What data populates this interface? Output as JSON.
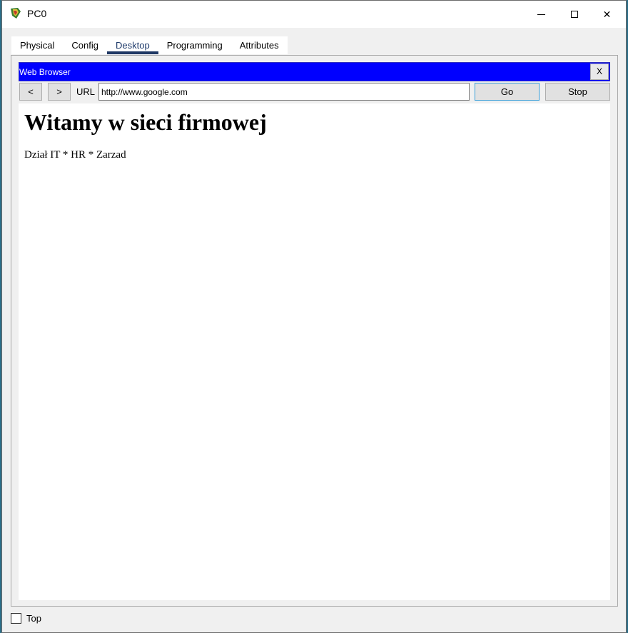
{
  "window": {
    "title": "PC0",
    "icon": "packet-tracer-pc-icon",
    "controls": {
      "minimize": "minimize-icon",
      "maximize": "maximize-icon",
      "close": "✕"
    }
  },
  "tabs": [
    {
      "label": "Physical",
      "active": false
    },
    {
      "label": "Config",
      "active": false
    },
    {
      "label": "Desktop",
      "active": true
    },
    {
      "label": "Programming",
      "active": false
    },
    {
      "label": "Attributes",
      "active": false
    }
  ],
  "browser": {
    "title": "Web Browser",
    "close_label": "X",
    "title_bar_color": "#0000ff",
    "back_label": "<",
    "forward_label": ">",
    "url_label": "URL",
    "url_value": "http://www.google.com",
    "go_label": "Go",
    "stop_label": "Stop"
  },
  "page": {
    "heading": "Witamy w sieci firmowej",
    "text": "Dział IT * HR * Zarzad"
  },
  "footer": {
    "top_label": "Top",
    "top_checked": false
  }
}
